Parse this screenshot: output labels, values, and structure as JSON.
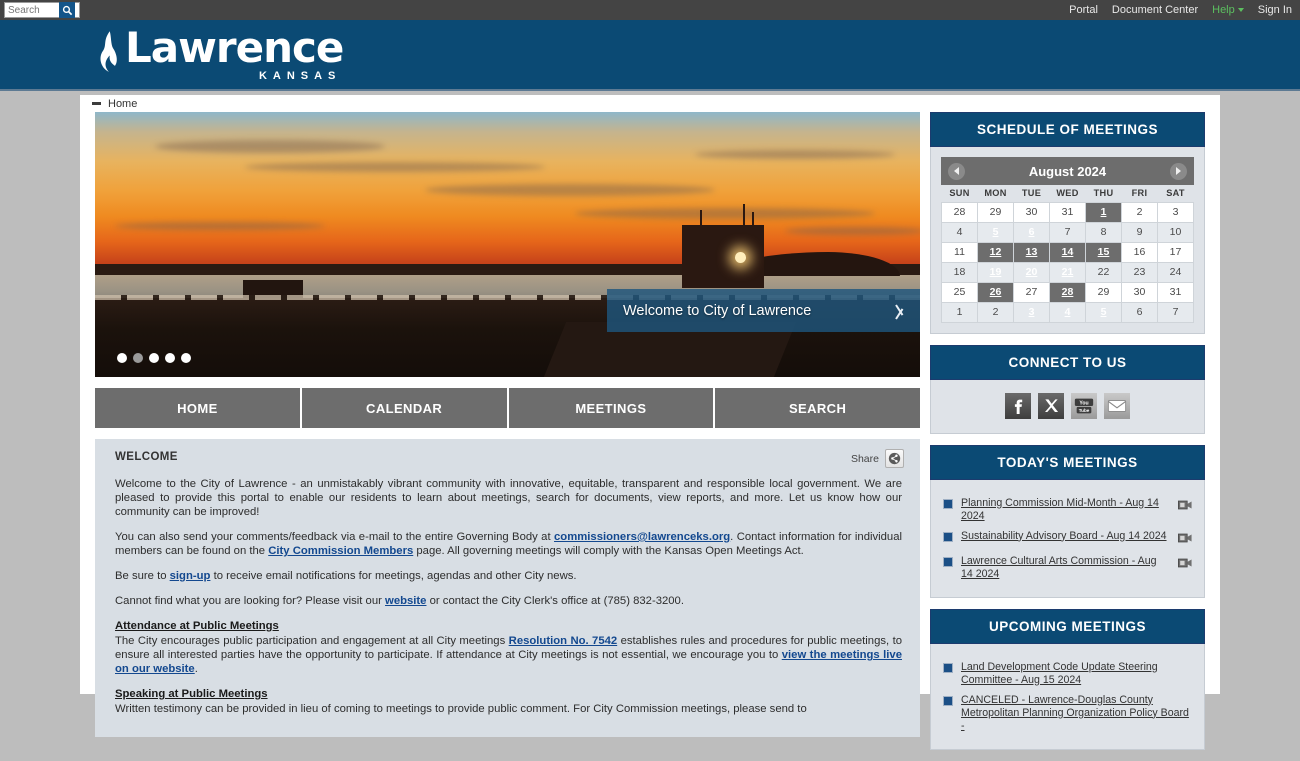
{
  "topbar": {
    "search_placeholder": "Search",
    "search_value": "",
    "search_icon": "magnifier-icon",
    "links": [
      {
        "label": "Portal",
        "name": "portal"
      },
      {
        "label": "Document Center",
        "name": "document-center"
      },
      {
        "label": "Help",
        "name": "help",
        "has_caret": true
      },
      {
        "label": "Sign In",
        "name": "sign-in"
      }
    ],
    "help_color": "#5cbf60"
  },
  "brand": {
    "name": "Lawrence",
    "state": "KANSAS",
    "icon": "flame-icon",
    "background": "#0b4a74"
  },
  "breadcrumb": {
    "label": "Home",
    "icon": "dash-icon"
  },
  "hero": {
    "caption": "Welcome to City of Lawrence",
    "next_icon": "chevron-right-icon",
    "slide_count": 5,
    "active_slide": 2,
    "alt": "Sunset over Clinton Lake dam with control tower"
  },
  "navtabs": [
    {
      "label": "HOME",
      "name": "home"
    },
    {
      "label": "CALENDAR",
      "name": "calendar"
    },
    {
      "label": "MEETINGS",
      "name": "meetings"
    },
    {
      "label": "SEARCH",
      "name": "search"
    }
  ],
  "welcome": {
    "heading": "WELCOME",
    "share_label": "Share",
    "share_icon": "share-icon",
    "p1": "Welcome to the City of Lawrence - an unmistakably vibrant community with innovative, equitable, transparent and responsible local government. We are pleased to provide this portal to enable our residents to learn about meetings, search for documents, view reports, and more. Let us know how our community can be improved!",
    "p2_a": "You can also send your comments/feedback via e-mail to the entire Governing Body at ",
    "p2_link1": "commissioners@lawrenceks.org",
    "p2_b": ". Contact information for individual members can be found on the ",
    "p2_link2": "City Commission Members",
    "p2_c": " page. All governing meetings will comply with the Kansas Open Meetings Act.",
    "p3_a": "Be sure to ",
    "p3_link": "sign-up",
    "p3_b": " to receive email notifications for meetings, agendas and other City news.",
    "p4_a": "Cannot find what you are looking for? Please visit our ",
    "p4_link": "website",
    "p4_b": " or contact the City Clerk's office at (785) 832-3200.",
    "sub1": "Attendance at Public Meetings",
    "p5_a": "The City encourages public participation and engagement at all City meetings ",
    "p5_link1": "Resolution No. 7542",
    "p5_b": " establishes rules and procedures for public meetings, to ensure all interested parties have the opportunity to participate. If attendance at City meetings is not essential, we encourage you to ",
    "p5_link2": "view the meetings live on our website",
    "p5_c": ".",
    "sub2": "Speaking at Public Meetings",
    "p6": "Written testimony can be provided in lieu of coming to meetings to provide public comment. For City Commission meetings, please send to"
  },
  "schedule": {
    "title": "SCHEDULE OF MEETINGS",
    "month_label": "August 2024",
    "prev_icon": "chevron-left-icon",
    "next_icon": "chevron-right-icon",
    "weekdays": [
      "SUN",
      "MON",
      "TUE",
      "WED",
      "THU",
      "FRI",
      "SAT"
    ],
    "weeks": [
      [
        {
          "d": "28"
        },
        {
          "d": "29"
        },
        {
          "d": "30"
        },
        {
          "d": "31"
        },
        {
          "d": "1",
          "hl": true
        },
        {
          "d": "2"
        },
        {
          "d": "3"
        }
      ],
      [
        {
          "d": "4"
        },
        {
          "d": "5",
          "hl": true
        },
        {
          "d": "6",
          "hl": true
        },
        {
          "d": "7"
        },
        {
          "d": "8"
        },
        {
          "d": "9"
        },
        {
          "d": "10"
        }
      ],
      [
        {
          "d": "11"
        },
        {
          "d": "12",
          "hl": true
        },
        {
          "d": "13",
          "hl": true
        },
        {
          "d": "14",
          "hl": true
        },
        {
          "d": "15",
          "hl": true
        },
        {
          "d": "16"
        },
        {
          "d": "17"
        }
      ],
      [
        {
          "d": "18"
        },
        {
          "d": "19",
          "hl": true
        },
        {
          "d": "20",
          "hl": true
        },
        {
          "d": "21",
          "hl": true
        },
        {
          "d": "22"
        },
        {
          "d": "23"
        },
        {
          "d": "24"
        }
      ],
      [
        {
          "d": "25"
        },
        {
          "d": "26",
          "hl": true
        },
        {
          "d": "27"
        },
        {
          "d": "28",
          "hl": true
        },
        {
          "d": "29"
        },
        {
          "d": "30"
        },
        {
          "d": "31"
        }
      ],
      [
        {
          "d": "1"
        },
        {
          "d": "2"
        },
        {
          "d": "3",
          "hl": true
        },
        {
          "d": "4",
          "hl": true
        },
        {
          "d": "5",
          "hl": true
        },
        {
          "d": "6"
        },
        {
          "d": "7"
        }
      ]
    ]
  },
  "connect": {
    "title": "CONNECT TO US",
    "icons": [
      {
        "name": "facebook-icon",
        "label": "f"
      },
      {
        "name": "x-twitter-icon",
        "label": "X"
      },
      {
        "name": "youtube-icon",
        "label": "You Tube"
      },
      {
        "name": "email-icon",
        "label": "envelope"
      }
    ]
  },
  "todays_meetings": {
    "title": "TODAY'S MEETINGS",
    "items": [
      {
        "label": "Planning Commission Mid-Month - Aug 14 2024",
        "video_icon": "video-camera-icon"
      },
      {
        "label": "Sustainability Advisory Board - Aug 14 2024",
        "video_icon": "video-camera-icon"
      },
      {
        "label": "Lawrence Cultural Arts Commission - Aug 14 2024",
        "video_icon": "video-camera-icon"
      }
    ]
  },
  "upcoming_meetings": {
    "title": "UPCOMING MEETINGS",
    "items": [
      {
        "label": "Land Development Code Update Steering Committee - Aug 15 2024"
      },
      {
        "label": "CANCELED - Lawrence-Douglas County Metropolitan Planning Organization Policy Board -"
      }
    ]
  },
  "colors": {
    "brand_blue": "#0b4a74",
    "topbar_gray": "#444444",
    "tab_gray": "#6d6d6d",
    "panel_gray": "#d8dee4",
    "link_blue": "#13488f",
    "help_green": "#5cbf60"
  }
}
